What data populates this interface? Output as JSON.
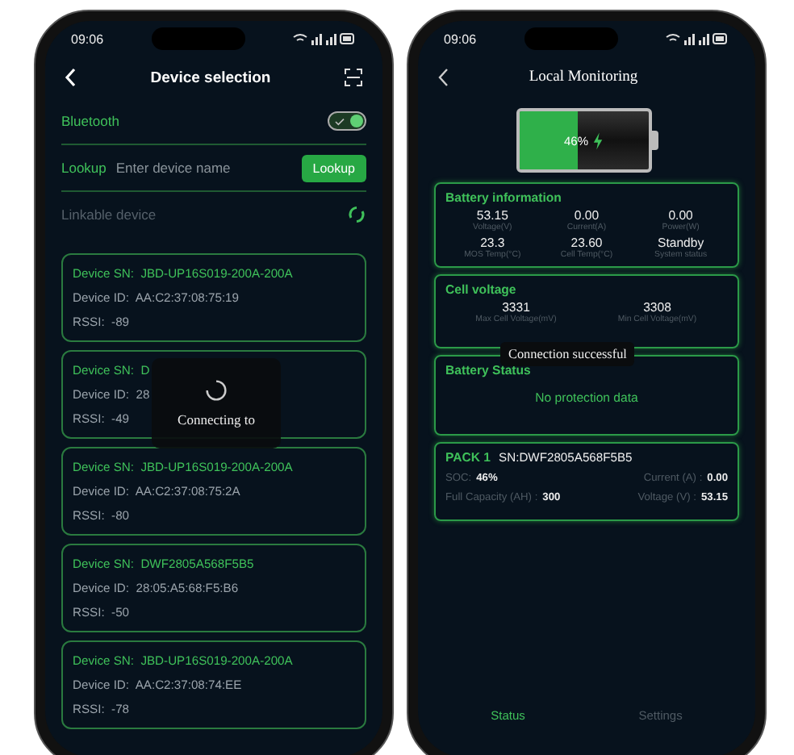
{
  "phones": [
    {
      "status_bar": {
        "time": "09:06"
      },
      "header": {
        "title": "Device selection"
      },
      "bluetooth": {
        "label": "Bluetooth",
        "on": true
      },
      "lookup": {
        "label": "Lookup",
        "placeholder": "Enter device name",
        "button": "Lookup"
      },
      "linkable": {
        "label": "Linkable device"
      },
      "devices": [
        {
          "sn_label": "Device SN:",
          "sn": "JBD-UP16S019-200A-200A",
          "id_label": "Device ID:",
          "id": "AA:C2:37:08:75:19",
          "rssi_label": "RSSI:",
          "rssi": "-89"
        },
        {
          "sn_label": "Device SN:",
          "sn": "D",
          "id_label": "Device ID:",
          "id": "28",
          "rssi_label": "RSSI:",
          "rssi": "-49"
        },
        {
          "sn_label": "Device SN:",
          "sn": "JBD-UP16S019-200A-200A",
          "id_label": "Device ID:",
          "id": "AA:C2:37:08:75:2A",
          "rssi_label": "RSSI:",
          "rssi": "-80"
        },
        {
          "sn_label": "Device SN:",
          "sn": "DWF2805A568F5B5",
          "id_label": "Device ID:",
          "id": "28:05:A5:68:F5:B6",
          "rssi_label": "RSSI:",
          "rssi": "-50"
        },
        {
          "sn_label": "Device SN:",
          "sn": "JBD-UP16S019-200A-200A",
          "id_label": "Device ID:",
          "id": "AA:C2:37:08:74:EE",
          "rssi_label": "RSSI:",
          "rssi": "-78"
        }
      ],
      "overlay": {
        "text": "Connecting to"
      }
    },
    {
      "status_bar": {
        "time": "09:06"
      },
      "header": {
        "title": "Local Monitoring"
      },
      "battery": {
        "level": 0.46,
        "text": "46%",
        "charging": true
      },
      "info": {
        "title": "Battery information",
        "metrics": [
          {
            "value": "53.15",
            "label": "Voltage(V)"
          },
          {
            "value": "0.00",
            "label": "Current(A)"
          },
          {
            "value": "0.00",
            "label": "Power(W)"
          },
          {
            "value": "23.3",
            "label": "MOS Temp(°C)"
          },
          {
            "value": "23.60",
            "label": "Cell Temp(°C)"
          },
          {
            "value": "Standby",
            "label": "System status"
          }
        ]
      },
      "cells": {
        "title": "Cell voltage",
        "metrics": [
          {
            "value": "3331",
            "label": "Max Cell Voltage(mV)"
          },
          {
            "value": "3308",
            "label": "Min Cell Voltage(mV)"
          }
        ]
      },
      "toast": "Connection successful",
      "status": {
        "title": "Battery Status",
        "text": "No protection data"
      },
      "pack": {
        "name": "PACK 1",
        "sn": "SN:DWF2805A568F5B5",
        "soc_label": "SOC:",
        "soc": "46%",
        "current_label": "Current (A) :",
        "current": "0.00",
        "capacity_label": "Full Capacity (AH) :",
        "capacity": "300",
        "voltage_label": "Voltage (V) :",
        "voltage": "53.15"
      },
      "tabs": [
        {
          "label": "Status",
          "selected": true
        },
        {
          "label": "Settings",
          "selected": false
        }
      ]
    }
  ]
}
